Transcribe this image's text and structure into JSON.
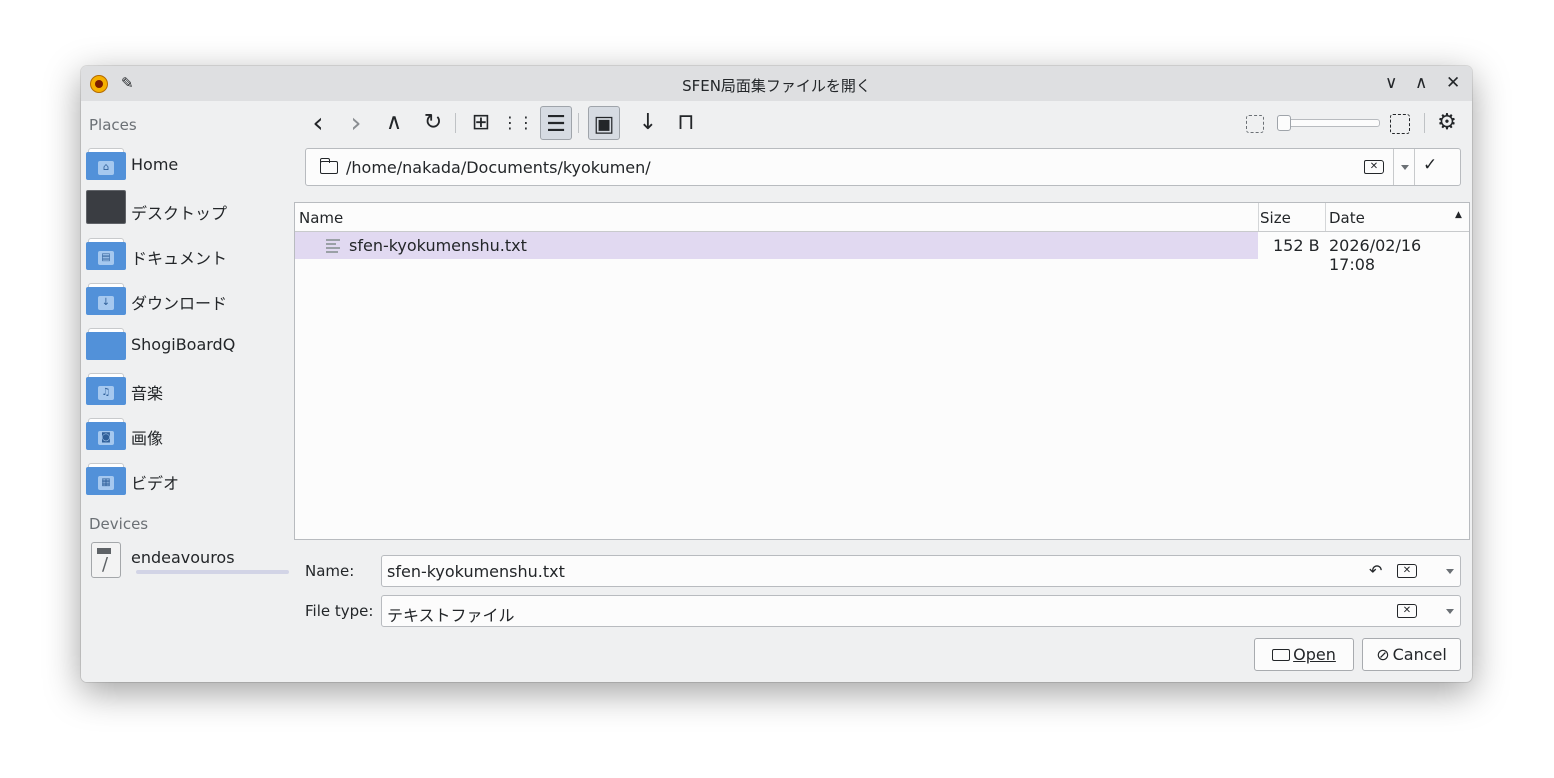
{
  "window": {
    "title": "SFEN局面集ファイルを開く",
    "controls": [
      "∨",
      "∧",
      "✕"
    ]
  },
  "sidebar": {
    "places_label": "Places",
    "places": [
      {
        "label": "Home",
        "icon": "home-folder-icon",
        "glyph": "⌂"
      },
      {
        "label": "デスクトップ",
        "icon": "desktop-icon",
        "glyph": ""
      },
      {
        "label": "ドキュメント",
        "icon": "documents-folder-icon",
        "glyph": "▤"
      },
      {
        "label": "ダウンロード",
        "icon": "downloads-folder-icon",
        "glyph": "↓"
      },
      {
        "label": "ShogiBoardQ",
        "icon": "folder-icon",
        "glyph": ""
      },
      {
        "label": "音楽",
        "icon": "music-folder-icon",
        "glyph": "♫"
      },
      {
        "label": "画像",
        "icon": "pictures-folder-icon",
        "glyph": "◙"
      },
      {
        "label": "ビデオ",
        "icon": "videos-folder-icon",
        "glyph": "▦"
      }
    ],
    "devices_label": "Devices",
    "devices": [
      {
        "label": "endeavouros",
        "icon": "drive-icon"
      }
    ]
  },
  "toolbar": {
    "back": "‹",
    "forward": "›",
    "up": "∧",
    "reload": "↻",
    "icons_view": "⊞",
    "compact_view": "⋮⋮",
    "detail_view": "☰",
    "preview": "▣",
    "sort": "↓",
    "bookmark": "⊓",
    "options": "⚙"
  },
  "location": {
    "path": "/home/nakada/Documents/kyokumen/"
  },
  "file_list": {
    "columns": {
      "name": "Name",
      "size": "Size",
      "date": "Date"
    },
    "sort_indicator": "▲",
    "rows": [
      {
        "name": "sfen-kyokumenshu.txt",
        "size": "152 B",
        "date": "2026/02/16 17:08",
        "selected": true
      }
    ]
  },
  "form": {
    "name_label": "Name:",
    "name_value": "sfen-kyokumenshu.txt",
    "type_label": "File type:",
    "type_value": "テキストファイル",
    "undo_glyph": "↶"
  },
  "buttons": {
    "open": "Open",
    "cancel": "Cancel"
  }
}
